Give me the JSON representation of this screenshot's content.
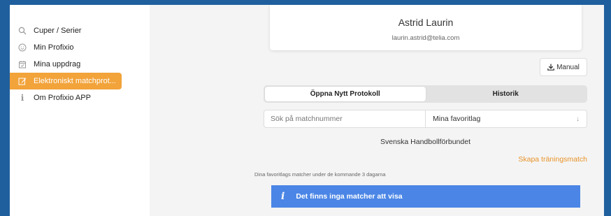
{
  "sidebar": {
    "items": [
      {
        "label": "Cuper / Serier",
        "icon": "search-icon",
        "active": false
      },
      {
        "label": "Min Profixio",
        "icon": "smiley-icon",
        "active": false
      },
      {
        "label": "Mina uppdrag",
        "icon": "calendar-icon",
        "active": false
      },
      {
        "label": "Elektroniskt matchprot...",
        "icon": "edit-icon",
        "active": true
      },
      {
        "label": "Om Profixio APP",
        "icon": "info-icon",
        "active": false
      }
    ]
  },
  "profile": {
    "name": "Astrid Laurin",
    "email": "laurin.astrid@telia.com"
  },
  "toolbar": {
    "manual_label": "Manual"
  },
  "tabs": [
    {
      "label": "Öppna Nytt Protokoll",
      "active": true
    },
    {
      "label": "Historik",
      "active": false
    }
  ],
  "search": {
    "placeholder": "Sök på matchnummer",
    "value": ""
  },
  "favorites_select": {
    "selected": "Mina favoritlag"
  },
  "federation": "Svenska Handbollförbundet",
  "create_training_match": "Skapa träningsmatch",
  "favorites_info": "Dina favoritlags matcher under de kommande 3 dagarna",
  "alert": {
    "message": "Det finns inga matcher att visa"
  },
  "colors": {
    "accent": "#f2a33a",
    "link": "#e8932a",
    "alert_bg": "#4b86e6",
    "outer_bg": "#1f5f9e"
  }
}
